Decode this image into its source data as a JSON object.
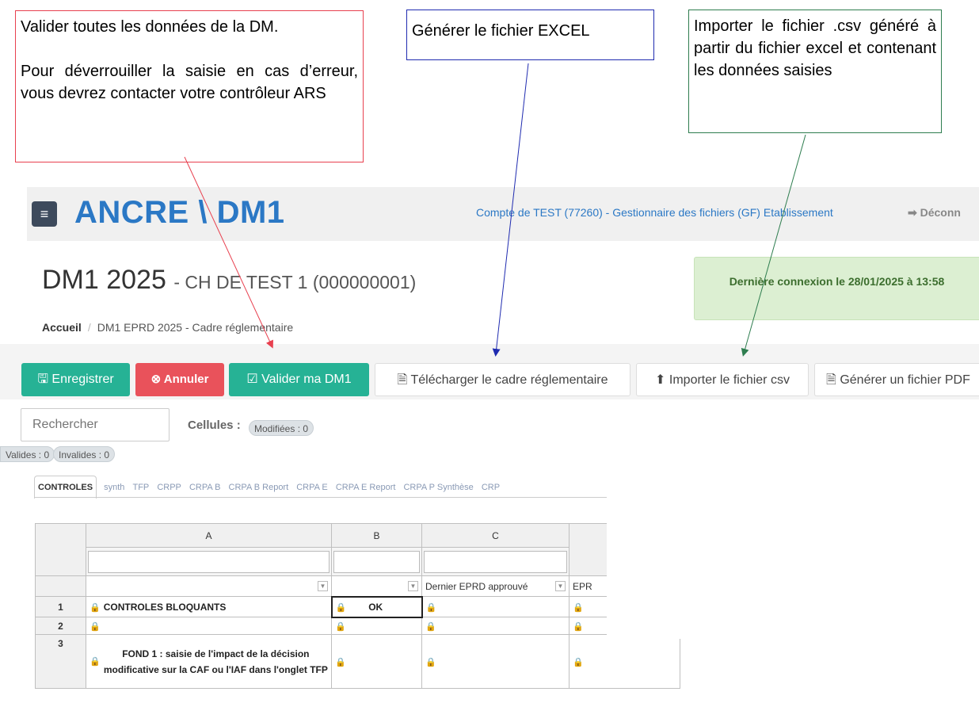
{
  "callouts": {
    "validate_line1": "Valider toutes les données de la DM.",
    "validate_line2": "Pour déverrouiller la saisie en cas d’erreur, vous devrez contacter votre contrôleur ARS",
    "excel": "Générer le fichier EXCEL",
    "import": "Importer le fichier .csv généré à partir du fichier excel et contenant les données saisies"
  },
  "header": {
    "menu_icon": "≡",
    "app_title": "ANCRE \\ DM1",
    "account": "Compte de TEST (77260) - Gestionnaire des fichiers (GF) Etablissement",
    "logout": "Déconn"
  },
  "page": {
    "title": "DM1 2025",
    "subtitle": "- CH DE TEST 1 (000000001)",
    "last_login": "Dernière connexion le 28/01/2025 à 13:58"
  },
  "breadcrumb": {
    "home": "Accueil",
    "current": "DM1 EPRD 2025 - Cadre réglementaire"
  },
  "toolbar": {
    "save": "Enregistrer",
    "cancel": "Annuler",
    "validate": "Valider ma DM1",
    "download": "Télécharger le cadre réglementaire",
    "import": "Importer le fichier csv",
    "pdf": "Générer un fichier PDF"
  },
  "search": {
    "placeholder": "Rechercher"
  },
  "counters": {
    "cells_label": "Cellules :",
    "modified": "Modifiées : 0",
    "valid": "Valides : 0",
    "invalid": "Invalides : 0"
  },
  "tabs": [
    "CONTROLES",
    "synth",
    "TFP",
    "CRPP",
    "CRPA B",
    "CRPA B Report",
    "CRPA E",
    "CRPA E Report",
    "CRPA P Synthèse",
    "CRP"
  ],
  "grid": {
    "columns": [
      "A",
      "B",
      "C"
    ],
    "subheader_c": "Dernier EPRD approuvé",
    "subheader_d": "EPR",
    "rows": [
      {
        "num": "1",
        "a": "CONTROLES BLOQUANTS",
        "b": "OK"
      },
      {
        "num": "2",
        "a": "",
        "b": ""
      },
      {
        "num": "3",
        "a": "FOND 1 : saisie de l'impact de la décision modificative sur la CAF ou l'IAF dans l'onglet TFP",
        "b": ""
      }
    ]
  },
  "colors": {
    "brand_blue": "#2b78c5",
    "success": "#26b295",
    "danger": "#e9525b",
    "callout_red": "#e8404f",
    "callout_blue": "#1f2bb0",
    "callout_green": "#2e7d4f"
  }
}
